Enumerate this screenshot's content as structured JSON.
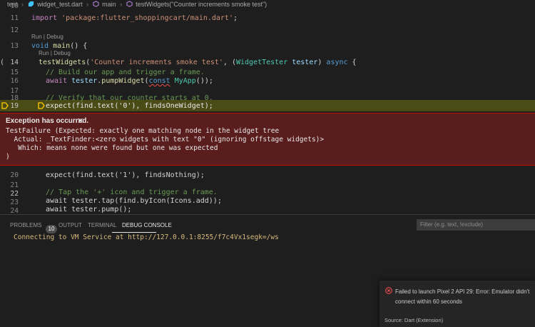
{
  "breadcrumb": {
    "folder": "test",
    "file": "widget_test.dart",
    "fn1": "main",
    "fn2": "testWidgets(\"Counter increments smoke test\")"
  },
  "editor": {
    "codelens_label": "Run | Debug",
    "lines_top": [
      {
        "num": "10",
        "text": ""
      },
      {
        "num": "11",
        "import_kw": "import",
        "import_str": "'package:flutter_shoppingcart/main.dart'",
        "tail": ";"
      },
      {
        "num": "12",
        "text": ""
      },
      {
        "num": "13",
        "kw": "void",
        "fn": "main",
        "tail": "() {"
      },
      {
        "num": "14",
        "fn": "testWidgets",
        "str": "'Counter increments smoke test'",
        "ty": "WidgetTester",
        "var": "tester",
        "kw": "async",
        "tail": " {"
      },
      {
        "num": "15",
        "comment": "// Build our app and trigger a frame."
      },
      {
        "num": "16",
        "kw": "await",
        "obj": "tester",
        "method": "pumpWidget",
        "const": "const",
        "cls": "MyApp",
        "tail": "());"
      },
      {
        "num": "17",
        "text": ""
      },
      {
        "num": "18",
        "comment": "// Verify that our counter starts at 0."
      },
      {
        "num": "19",
        "text": "expect(find.text('0'), findsOneWidget);"
      }
    ],
    "lines_bottom": [
      {
        "num": "20",
        "text": "expect(find.text('1'), findsNothing);"
      },
      {
        "num": "21",
        "text": ""
      },
      {
        "num": "22",
        "comment": "// Tap the '+' icon and trigger a frame."
      },
      {
        "num": "23",
        "text": "await tester.tap(find.byIcon(Icons.add));"
      },
      {
        "num": "24",
        "text": "await tester.pump();"
      }
    ]
  },
  "exception": {
    "title": "Exception has occurred.",
    "close": "✕",
    "lines": [
      "TestFailure (Expected: exactly one matching node in the widget tree",
      "  Actual: _TextFinder:<zero widgets with text \"0\" (ignoring offstage widgets)>",
      "   Which: means none were found but one was expected",
      ")"
    ]
  },
  "panel": {
    "tabs": {
      "problems": "PROBLEMS",
      "problems_count": "10",
      "output": "OUTPUT",
      "terminal": "TERMINAL",
      "debug_console": "DEBUG CONSOLE"
    },
    "filter_placeholder": "Filter (e.g. text, !exclude)",
    "console_output": "Connecting to VM Service at http://127.0.0.1:8255/f7c4Vx1segk=/ws"
  },
  "notification": {
    "message": "Failed to launch Pixel 2 API 29: Error: Emulator didn't connect within 60 seconds",
    "source": "Source: Dart (Extension)"
  },
  "colors": {
    "exception_bg": "#5a1d1d",
    "highlight_line": "#4b4b18",
    "console_text": "#d7ba7d",
    "error_icon": "#f14c4c"
  }
}
